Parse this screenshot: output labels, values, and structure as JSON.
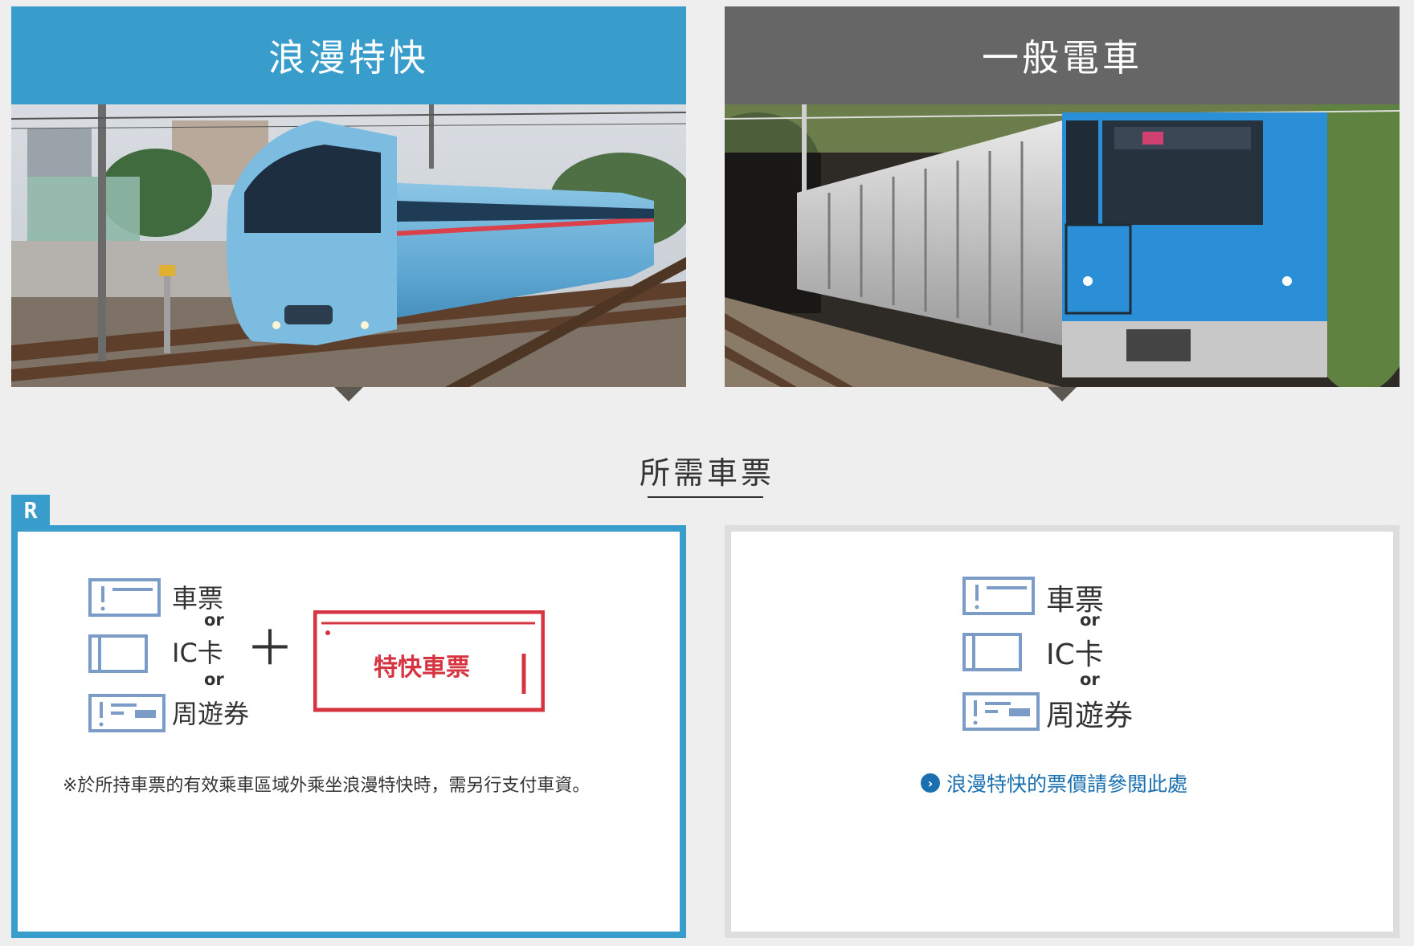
{
  "cards": {
    "romancecar": {
      "title": "浪漫特快",
      "header_color": "#399dcb"
    },
    "local": {
      "title": "一般電車",
      "header_color": "#666666"
    }
  },
  "section": {
    "title": "所需車票"
  },
  "left_panel": {
    "badge": "R",
    "tickets": [
      "車票",
      "IC卡",
      "周遊券"
    ],
    "or_text": "or",
    "plus": "＋",
    "express_ticket": "特快車票",
    "note": "※於所持車票的有效乘車區域外乘坐浪漫特快時，需另行支付車資。"
  },
  "right_panel": {
    "tickets": [
      "車票",
      "IC卡",
      "周遊券"
    ],
    "or_text": "or",
    "link_text": "浪漫特快的票價請參閱此處"
  },
  "colors": {
    "accent_blue": "#399dcb",
    "header_gray": "#666666",
    "express_red": "#d63440",
    "link_blue": "#1a6fb0",
    "ticket_icon": "#7a9cc6"
  }
}
